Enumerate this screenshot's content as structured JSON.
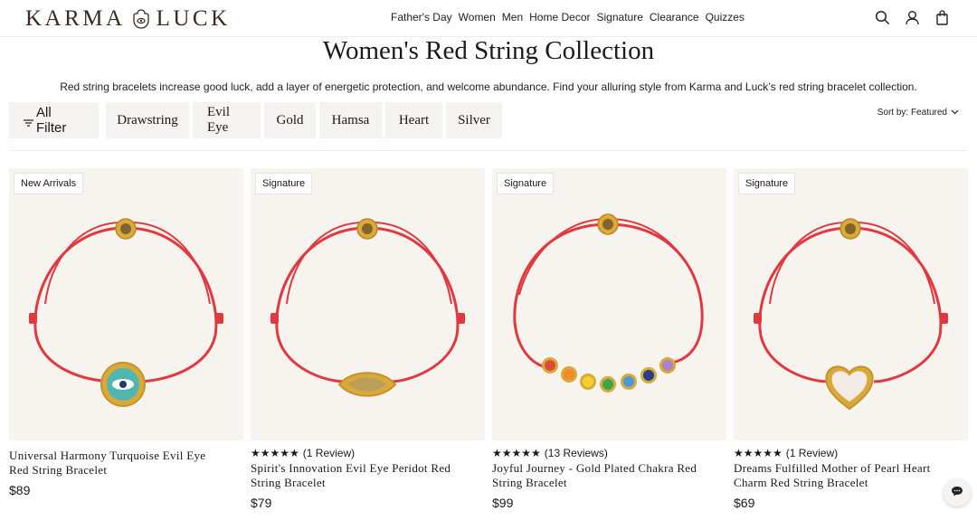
{
  "header": {
    "logo_left": "KARMA",
    "logo_right": "LUCK",
    "nav": [
      "Father's Day",
      "Women",
      "Men",
      "Home Decor",
      "Signature",
      "Clearance",
      "Quizzes"
    ]
  },
  "page": {
    "title": "Women's Red String Collection",
    "subtitle": "Red string bracelets increase good luck, add a layer of energetic protection, and welcome abundance. Find your alluring style from Karma and Luck’s red string bracelet collection."
  },
  "filters": {
    "all_label": "All Filter",
    "chips": [
      "Drawstring",
      "Evil Eye",
      "Gold",
      "Hamsa",
      "Heart",
      "Silver"
    ],
    "sort_label": "Sort by: Featured"
  },
  "products": [
    {
      "badge": "New Arrivals",
      "stars": "",
      "reviews": "",
      "name_line1": "Universal Harmony Turquoise Evil Eye",
      "name_line2": "Red String Bracelet",
      "price": "$89",
      "charm": "evil-eye-round"
    },
    {
      "badge": "Signature",
      "stars": "★★★★★",
      "reviews": "(1 Review)",
      "name_line1": "Spirit's Innovation Evil Eye Peridot Red",
      "name_line2": "String Bracelet",
      "price": "$79",
      "charm": "eye-marquise"
    },
    {
      "badge": "Signature",
      "stars": "★★★★★",
      "reviews": "(13 Reviews)",
      "name_line1": "Joyful Journey - Gold Plated Chakra Red",
      "name_line2": "String Bracelet",
      "price": "$99",
      "charm": "chakra"
    },
    {
      "badge": "Signature",
      "stars": "★★★★★",
      "reviews": "(1 Review)",
      "name_line1": "Dreams Fulfilled Mother of Pearl Heart",
      "name_line2": "Charm Red String Bracelet",
      "price": "$69",
      "charm": "heart"
    }
  ],
  "colors": {
    "string_red": "#e0393f",
    "gold": "#d9a93a",
    "card_bg": "#f7f3ef",
    "chip_bg": "#f4f3f1"
  },
  "icons": [
    "search-icon",
    "account-icon",
    "bag-icon",
    "filter-icon",
    "chevron-down-icon",
    "chat-icon"
  ]
}
